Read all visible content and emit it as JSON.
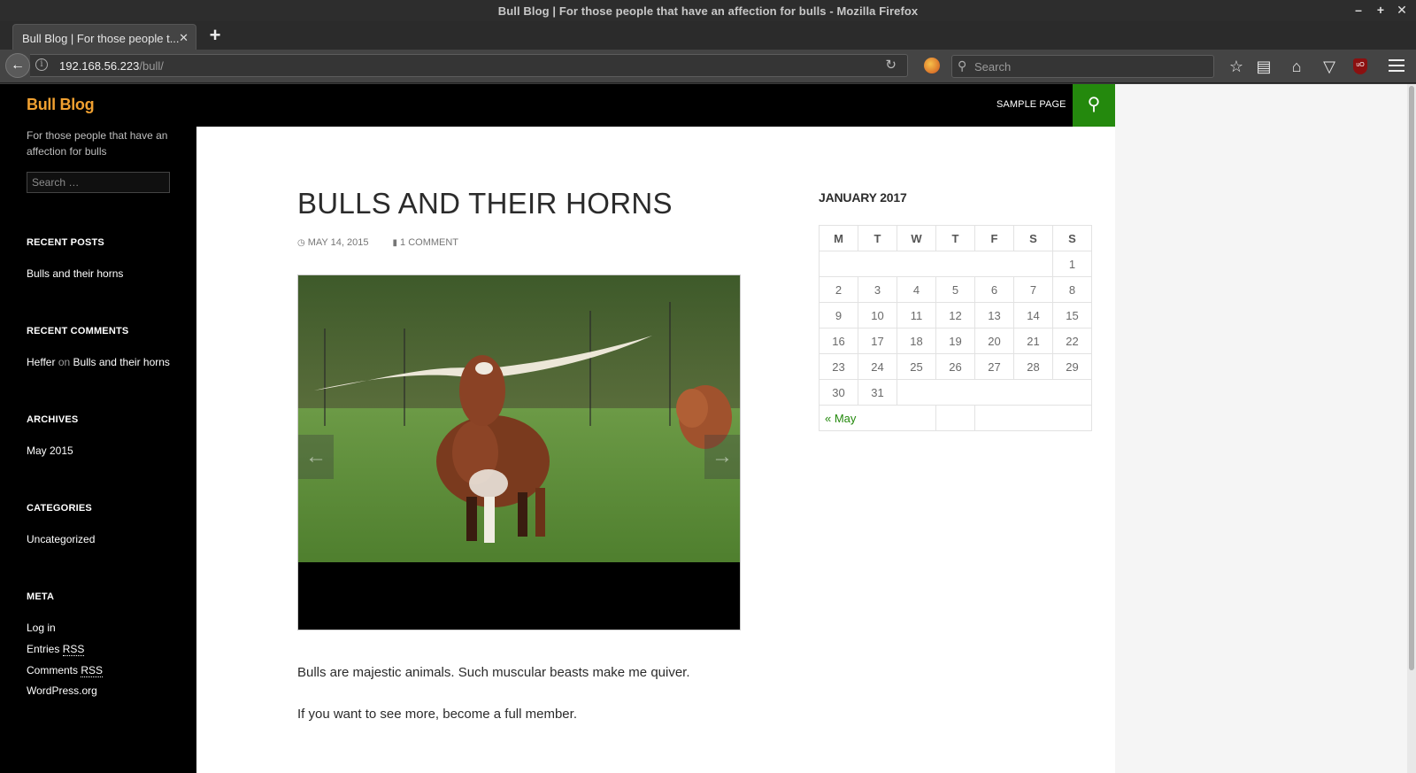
{
  "window": {
    "title": "Bull Blog | For those people that have an affection for bulls - Mozilla Firefox",
    "controls": [
      "–",
      "+",
      "✕"
    ]
  },
  "tab": {
    "title": "Bull Blog | For those people t...",
    "close": "✕",
    "new_tab": "+"
  },
  "navbar": {
    "url_host": "192.168.56.223",
    "url_path": "/bull/",
    "search_placeholder": "Search"
  },
  "site": {
    "title": "Bull Blog",
    "description": "For those people that have an affection for bulls",
    "search_placeholder": "Search …"
  },
  "menu": {
    "sample_page": "SAMPLE PAGE"
  },
  "widgets": {
    "recent_posts": {
      "title": "RECENT POSTS",
      "items": [
        "Bulls and their horns"
      ]
    },
    "recent_comments": {
      "title": "RECENT COMMENTS",
      "author": "Heffer",
      "on": "on",
      "post": "Bulls and their horns"
    },
    "archives": {
      "title": "ARCHIVES",
      "items": [
        "May 2015"
      ]
    },
    "categories": {
      "title": "CATEGORIES",
      "items": [
        "Uncategorized"
      ]
    },
    "meta": {
      "title": "META",
      "login": "Log in",
      "entries": "Entries",
      "comments": "Comments",
      "rss": "RSS",
      "wordpress": "WordPress.org"
    }
  },
  "post": {
    "title": "BULLS AND THEIR HORNS",
    "date": "MAY 14, 2015",
    "comments": "1 COMMENT",
    "paragraphs": [
      "Bulls are majestic animals. Such muscular beasts make me quiver.",
      "If you want to see more, become a full member."
    ]
  },
  "calendar": {
    "caption": "JANUARY 2017",
    "weekdays": [
      "M",
      "T",
      "W",
      "T",
      "F",
      "S",
      "S"
    ],
    "weeks": [
      [
        "",
        "",
        "",
        "",
        "",
        "",
        "1"
      ],
      [
        "2",
        "3",
        "4",
        "5",
        "6",
        "7",
        "8"
      ],
      [
        "9",
        "10",
        "11",
        "12",
        "13",
        "14",
        "15"
      ],
      [
        "16",
        "17",
        "18",
        "19",
        "20",
        "21",
        "22"
      ],
      [
        "23",
        "24",
        "25",
        "26",
        "27",
        "28",
        "29"
      ],
      [
        "30",
        "31",
        "",
        "",
        "",
        "",
        ""
      ]
    ],
    "prev_link": "« May"
  },
  "colors": {
    "accent_green": "#24890d",
    "site_title_orange": "#f0a030"
  }
}
